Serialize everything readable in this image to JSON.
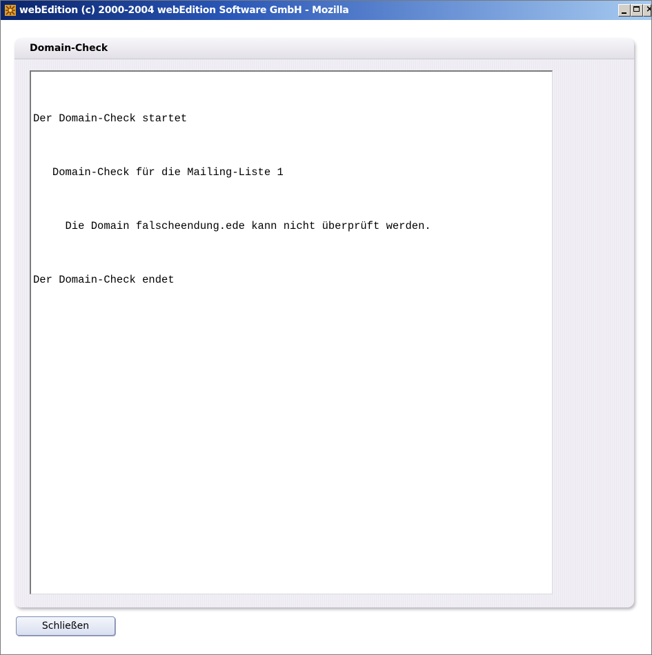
{
  "window": {
    "title": "webEdition (c) 2000-2004 webEdition Software GmbH - Mozilla",
    "controls": {
      "minimize": "minimize",
      "maximize": "maximize",
      "close": "×"
    }
  },
  "panel": {
    "title": "Domain-Check",
    "log_lines": [
      "Der Domain-Check startet",
      "   Domain-Check für die Mailing-Liste 1",
      "     Die Domain falscheendung.ede kann nicht überprüft werden.",
      "Der Domain-Check endet"
    ]
  },
  "footer": {
    "close_label": "Schließen"
  },
  "icons": {
    "app": "webedition-app-icon"
  },
  "colors": {
    "titlebar_start": "#0a246a",
    "titlebar_end": "#a6caf0",
    "panel_background": "#f3f1f6"
  }
}
